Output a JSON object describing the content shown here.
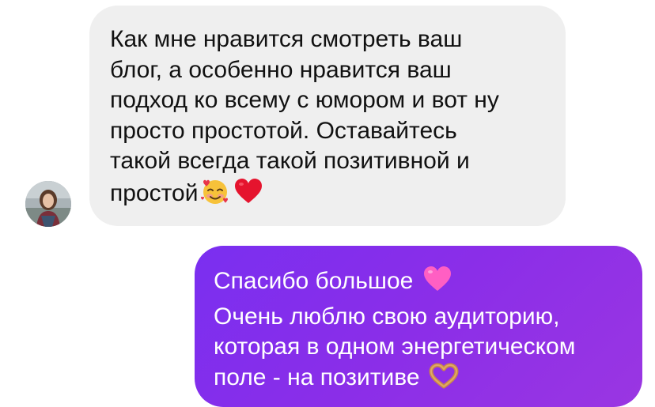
{
  "conversation": {
    "incoming": {
      "lines": [
        "Как мне нравится смотреть ваш",
        "блог, а особенно нравится ваш",
        "подход ко всему с юмором и вот ну",
        "просто простотой. Оставайтесь",
        "такой всегда такой позитивной и",
        "простой"
      ],
      "emojis": [
        "smiling-face-with-hearts-icon",
        "red-heart-icon"
      ]
    },
    "outgoing": {
      "lines": [
        "Спасибо большое",
        "Очень люблю свою аудиторию,",
        "которая в одном энергетическом",
        "поле - на позитиве"
      ],
      "emojis": [
        "pink-heart-icon",
        "heart-hands-icon"
      ]
    }
  },
  "colors": {
    "incoming_bubble": "#efefef",
    "outgoing_bubble_start": "#7a2ff0",
    "outgoing_bubble_end": "#9a36e2"
  }
}
